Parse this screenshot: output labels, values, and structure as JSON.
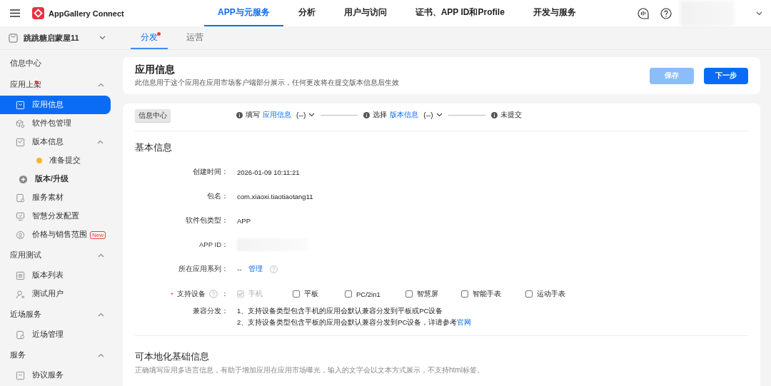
{
  "header": {
    "brand": "AppGallery Connect",
    "nav": [
      {
        "label": "APP与元服务",
        "selected": true
      },
      {
        "label": "分析",
        "selected": false
      },
      {
        "label": "用户与访问",
        "selected": false
      },
      {
        "label": "证书、APP ID和Profile",
        "selected": false
      },
      {
        "label": "开发与服务",
        "selected": false
      }
    ]
  },
  "app_selector": {
    "name": "跳跳糖启蒙屋11"
  },
  "tabs": [
    {
      "label": "分发",
      "selected": true,
      "dot": true
    },
    {
      "label": "运营",
      "selected": false,
      "dot": false
    }
  ],
  "sidebar": {
    "entries": [
      {
        "kind": "link",
        "label": "信息中心"
      },
      {
        "kind": "group",
        "label": "应用上架",
        "dot": true,
        "expanded": true,
        "items": [
          {
            "kind": "page",
            "label": "应用信息",
            "selected": true
          },
          {
            "kind": "page",
            "label": "软件包管理",
            "selected": false
          },
          {
            "kind": "page",
            "label": "版本信息",
            "selected": false,
            "expanded": true,
            "children": [
              {
                "label": "准备提交",
                "color": "#fbb52a",
                "selected": false
              }
            ]
          },
          {
            "kind": "action",
            "label": "版本/升级",
            "selected": false
          },
          {
            "kind": "page",
            "label": "服务素材",
            "selected": false
          },
          {
            "kind": "page",
            "label": "智慧分发配置",
            "selected": false
          },
          {
            "kind": "page",
            "label": "价格与销售范围",
            "selected": false,
            "badge": "New"
          }
        ]
      },
      {
        "kind": "group",
        "label": "应用测试",
        "dot": false,
        "expanded": true,
        "items": [
          {
            "kind": "page",
            "label": "版本列表",
            "selected": false
          },
          {
            "kind": "page",
            "label": "测试用户",
            "selected": false
          }
        ]
      },
      {
        "kind": "group",
        "label": "近场服务",
        "dot": false,
        "expanded": true,
        "items": [
          {
            "kind": "page",
            "label": "近场管理",
            "selected": false
          }
        ]
      },
      {
        "kind": "group",
        "label": "服务",
        "dot": false,
        "expanded": true,
        "items": [
          {
            "kind": "page",
            "label": "协议服务",
            "selected": false
          }
        ]
      }
    ]
  },
  "page_header": {
    "title": "应用信息",
    "description": "此信息用于这个应用在应用市场客户端部分展示，任何更改将在提交版本信息后生效",
    "buttons": [
      {
        "label": "保存",
        "disabled": true
      },
      {
        "label": "下一步",
        "disabled": false
      }
    ]
  },
  "info_tag": "信息中心",
  "steps": [
    {
      "action": "填写",
      "link": "应用信息",
      "status": "(--)",
      "dropdown": true
    },
    {
      "action": "选择",
      "link": "版本信息",
      "status": "(--)",
      "dropdown": true
    },
    {
      "action": "未提交",
      "dropdown": false
    }
  ],
  "basic_info": {
    "title": "基本信息",
    "fields": [
      {
        "kind": "text",
        "label": "创建时间：",
        "value": "2026-01-09 10:11:21"
      },
      {
        "kind": "text",
        "label": "包名：",
        "value": "com.xiaoxi.tiaotiaotang11"
      },
      {
        "kind": "text",
        "label": "软件包类型：",
        "value": "APP"
      },
      {
        "kind": "hidden",
        "label": "APP ID："
      },
      {
        "kind": "series",
        "label": "所在应用系列：",
        "value": "--",
        "link": "管理"
      },
      {
        "kind": "devices",
        "label": "支持设备",
        "required_mark": "*",
        "colon": "：",
        "options": [
          {
            "label": "手机",
            "checked": true,
            "disabled": true
          },
          {
            "label": "平板",
            "checked": false,
            "disabled": false
          },
          {
            "label": "PC/2in1",
            "checked": false,
            "disabled": false
          },
          {
            "label": "智慧屏",
            "checked": false,
            "disabled": false
          },
          {
            "label": "智能手表",
            "checked": false,
            "disabled": false
          },
          {
            "label": "运动手表",
            "checked": false,
            "disabled": false
          }
        ]
      },
      {
        "kind": "notes",
        "label": "兼容分发：",
        "lines": [
          {
            "text": "1、支持设备类型包含手机的应用会默认兼容分发到平板或PC设备"
          },
          {
            "text": "2、支持设备类型包含平板的应用会默认兼容分发到PC设备，详请参考",
            "link": "官网"
          }
        ]
      }
    ]
  },
  "localizable_info": {
    "title": "可本地化基础信息",
    "description": "正确填写应用多语言信息，有助于增加应用在应用市场曝光，输入的文字会以文本方式展示，不支持html标签。"
  }
}
